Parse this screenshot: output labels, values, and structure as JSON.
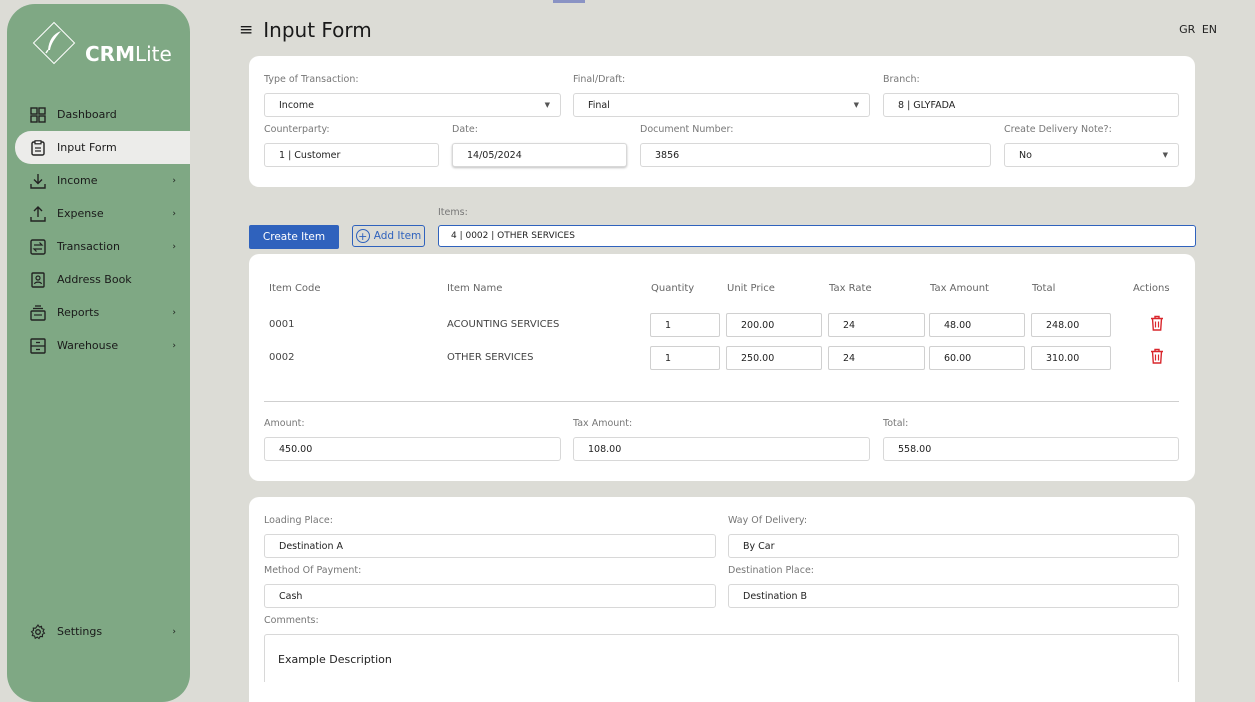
{
  "app": {
    "logo_text_bold": "CRM",
    "logo_text_light": "Lite"
  },
  "sidebar": {
    "items": [
      {
        "label": "Dashboard",
        "icon": "dashboard-icon",
        "arrow": false
      },
      {
        "label": "Input Form",
        "icon": "clipboard-icon",
        "arrow": false,
        "active": true
      },
      {
        "label": "Income",
        "icon": "download-icon",
        "arrow": true
      },
      {
        "label": "Expense",
        "icon": "upload-icon",
        "arrow": true
      },
      {
        "label": "Transaction",
        "icon": "transfer-icon",
        "arrow": true
      },
      {
        "label": "Address Book",
        "icon": "address-book-icon",
        "arrow": false
      },
      {
        "label": "Reports",
        "icon": "reports-icon",
        "arrow": true
      },
      {
        "label": "Warehouse",
        "icon": "warehouse-icon",
        "arrow": true
      }
    ],
    "settings_label": "Settings",
    "arrow_glyph": "›"
  },
  "header": {
    "menu_glyph": "≡",
    "title": "Input Form",
    "lang_gr": "GR",
    "lang_en": "EN"
  },
  "transaction": {
    "type_label": "Type of Transaction:",
    "type_value": "Income",
    "final_label": "Final/Draft:",
    "final_value": "Final",
    "branch_label": "Branch:",
    "branch_value": "8 | GLYFADA",
    "counterparty_label": "Counterparty:",
    "counterparty_value": "1 | Customer",
    "date_label": "Date:",
    "date_value": "14/05/2024",
    "docnum_label": "Document Number:",
    "docnum_value": "3856",
    "delivery_label": "Create Delivery Note?:",
    "delivery_value": "No",
    "caret_glyph": "▼"
  },
  "items_bar": {
    "create_label": "Create Item",
    "add_label": "Add Item",
    "add_glyph": "+",
    "items_label": "Items:",
    "items_value": "4 | 0002 | OTHER SERVICES"
  },
  "table": {
    "headers": [
      "Item Code",
      "Item Name",
      "Quantity",
      "Unit Price",
      "Tax Rate",
      "Tax Amount",
      "Total",
      "Actions"
    ],
    "rows": [
      {
        "code": "0001",
        "name": "ACOUNTING SERVICES",
        "qty": "1",
        "price": "200.00",
        "rate": "24",
        "tax": "48.00",
        "total": "248.00"
      },
      {
        "code": "0002",
        "name": "OTHER SERVICES",
        "qty": "1",
        "price": "250.00",
        "rate": "24",
        "tax": "60.00",
        "total": "310.00"
      }
    ]
  },
  "totals": {
    "amount_label": "Amount:",
    "amount_value": "450.00",
    "tax_label": "Tax Amount:",
    "tax_value": "108.00",
    "total_label": "Total:",
    "total_value": "558.00"
  },
  "delivery": {
    "loading_label": "Loading Place:",
    "loading_value": "Destination A",
    "way_label": "Way Of Delivery:",
    "way_value": "By Car",
    "payment_label": "Method Of Payment:",
    "payment_value": "Cash",
    "dest_label": "Destination Place:",
    "dest_value": "Destination B",
    "comments_label": "Comments:",
    "comments_value": "Example Description"
  },
  "colors": {
    "sidebar": "#7fa884",
    "primary": "#2f62bd",
    "danger": "#d9262c"
  }
}
